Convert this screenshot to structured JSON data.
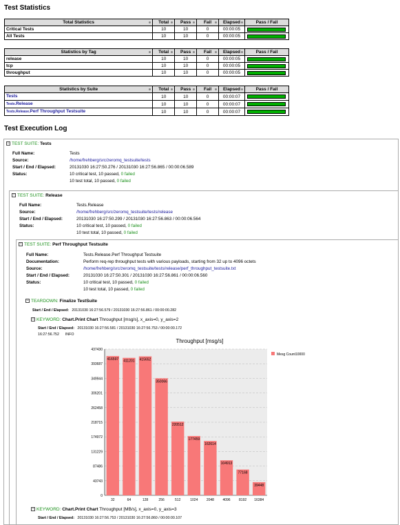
{
  "headings": {
    "test_statistics": "Test Statistics",
    "test_execution_log": "Test Execution Log"
  },
  "tables": {
    "total": {
      "headers": [
        "Total Statistics",
        "Total",
        "Pass",
        "Fail",
        "Elapsed",
        "Pass / Fail"
      ],
      "rows": [
        {
          "name": "Critical Tests",
          "total": "10",
          "pass": "10",
          "fail": "0",
          "elapsed": "00:00:05"
        },
        {
          "name": "All Tests",
          "total": "10",
          "pass": "10",
          "fail": "0",
          "elapsed": "00:00:05"
        }
      ]
    },
    "tag": {
      "headers": [
        "Statistics by Tag",
        "Total",
        "Pass",
        "Fail",
        "Elapsed",
        "Pass / Fail"
      ],
      "rows": [
        {
          "name": "release",
          "total": "10",
          "pass": "10",
          "fail": "0",
          "elapsed": "00:00:05"
        },
        {
          "name": "tcp",
          "total": "10",
          "pass": "10",
          "fail": "0",
          "elapsed": "00:00:05"
        },
        {
          "name": "throughput",
          "total": "10",
          "pass": "10",
          "fail": "0",
          "elapsed": "00:00:05"
        }
      ]
    },
    "suite": {
      "headers": [
        "Statistics by Suite",
        "Total",
        "Pass",
        "Fail",
        "Elapsed",
        "Pass / Fail"
      ],
      "rows": [
        {
          "prefix": "",
          "name": "Tests",
          "total": "10",
          "pass": "10",
          "fail": "0",
          "elapsed": "00:00:07"
        },
        {
          "prefix": "Tests.",
          "name": "Release",
          "total": "10",
          "pass": "10",
          "fail": "0",
          "elapsed": "00:00:07"
        },
        {
          "prefix": "Tests.Release.",
          "name": "Perf Throughput Testsuite",
          "total": "10",
          "pass": "10",
          "fail": "0",
          "elapsed": "00:00:07"
        }
      ]
    }
  },
  "labels": {
    "full_name": "Full Name:",
    "source": "Source:",
    "start_end": "Start / End / Elapsed:",
    "status": "Status:",
    "documentation": "Documentation:",
    "test_suite": "TEST SUITE:",
    "teardown": "TEARDOWN:",
    "keyword": "KEYWORD:",
    "start_end_small": "Start / End / Elapsed:"
  },
  "suite1": {
    "name": "Tests",
    "full_name": "Tests",
    "source": "/home/frehberg/src/zeromq_testsuite/tests",
    "times": "20131030 16:27:50.276 / 20131030 16:27:56.865 / 00:00:06.589",
    "status1": "10 critical test, 10 passed, ",
    "status1_fail": "0 failed",
    "status2": "10 test total, 10 passed, ",
    "status2_fail": "0 failed"
  },
  "suite2": {
    "name": "Release",
    "full_name": "Tests.Release",
    "source": "/home/frehberg/src/zeromq_testsuite/tests/release",
    "times": "20131030 16:27:50.299 / 20131030 16:27:56.863 / 00:00:06.564",
    "status1": "10 critical test, 10 passed, ",
    "status1_fail": "0 failed",
    "status2": "10 test total, 10 passed, ",
    "status2_fail": "0 failed"
  },
  "suite3": {
    "name": "Perf Throughput Testsuite",
    "full_name": "Tests.Release.Perf Throughput Testsuite",
    "documentation": "Perform req-rep throughput tests with various payloads, starting from 32 up to 4096 octets",
    "source": "/home/frehberg/src/zeromq_testsuite/tests/release/perf_throughput_testsuite.txt",
    "times": "20131030 16:27:50.301 / 20131030 16:27:56.861 / 00:00:06.560",
    "status1": "10 critical test, 10 passed, ",
    "status1_fail": "0 failed",
    "status2": "10 test total, 10 passed, ",
    "status2_fail": "0 failed"
  },
  "teardown": {
    "name": "Finalize TestSuite",
    "times": "20131030 16:27:56.579 / 20131030 16:27:56.861 / 00:00:00.282"
  },
  "keyword1": {
    "name": "Chart.Print Chart",
    "args": "Throughput [msg/s], x_axis=0, y_axis=2",
    "times": "20131030 16:27:56.581 / 20131030 16:27:56.753 / 00:00:00.172",
    "log_time": "16:27:56.752",
    "log_level": "INFO"
  },
  "keyword2": {
    "name": "Chart.Print Chart",
    "args": "Throughput [MB/s], x_axis=0, y_axis=3",
    "times": "20131030 16:27:56.753 / 20131030 16:27:56.860 / 00:00:00.107"
  },
  "colors": {
    "bar": "#f87878",
    "pass_bar": "#00b000",
    "plot_bg": "#ececec"
  },
  "chart_data": {
    "type": "bar",
    "title": "Throughput [msg/s]",
    "categories": [
      "32",
      "64",
      "128",
      "256",
      "512",
      "1024",
      "2048",
      "4096",
      "8192",
      "16384"
    ],
    "series": [
      {
        "name": "Mesg Count10000",
        "values": [
          416597,
          411201,
          415652,
          350066,
          220512,
          177459,
          162614,
          104913,
          77168,
          39448
        ]
      }
    ],
    "yticks": [
      "0",
      "43743",
      "87486",
      "131229",
      "174972",
      "218715",
      "262458",
      "306201",
      "349944",
      "393687",
      "437430"
    ],
    "ylim": [
      0,
      437430
    ],
    "grid": true,
    "legend": "top-right"
  }
}
